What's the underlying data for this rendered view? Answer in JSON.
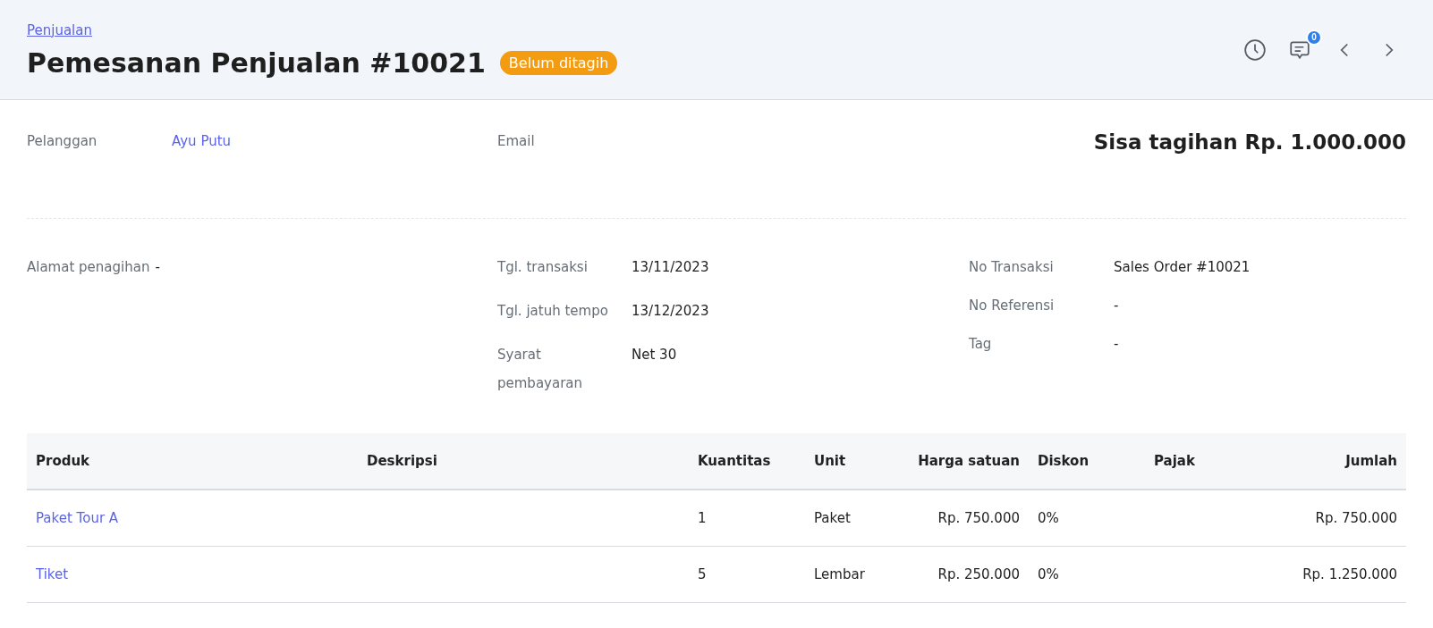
{
  "breadcrumb": "Penjualan",
  "title": "Pemesanan Penjualan #10021",
  "status_badge": "Belum ditagih",
  "comment_count": "0",
  "customer": {
    "label": "Pelanggan",
    "value": "Ayu Putu"
  },
  "email": {
    "label": "Email"
  },
  "balance": "Sisa tagihan Rp. 1.000.000",
  "billing_address": {
    "label": "Alamat penagihan",
    "value": "-"
  },
  "details_middle": [
    {
      "label": "Tgl. transaksi",
      "value": "13/11/2023"
    },
    {
      "label": "Tgl. jatuh tempo",
      "value": "13/12/2023"
    },
    {
      "label": "Syarat pembayaran",
      "value": "Net 30"
    }
  ],
  "details_right": [
    {
      "label": "No Transaksi",
      "value": "Sales Order #10021"
    },
    {
      "label": "No Referensi",
      "value": "-"
    },
    {
      "label": "Tag",
      "value": "-"
    }
  ],
  "table": {
    "columns": [
      "Produk",
      "Deskripsi",
      "Kuantitas",
      "Unit",
      "Harga satuan",
      "Diskon",
      "Pajak",
      "Jumlah"
    ],
    "rows": [
      [
        "Paket Tour A",
        "",
        "1",
        "Paket",
        "Rp. 750.000",
        "0%",
        "",
        "Rp. 750.000"
      ],
      [
        "Tiket",
        "",
        "5",
        "Lembar",
        "Rp. 250.000",
        "0%",
        "",
        "Rp. 1.250.000"
      ]
    ]
  }
}
